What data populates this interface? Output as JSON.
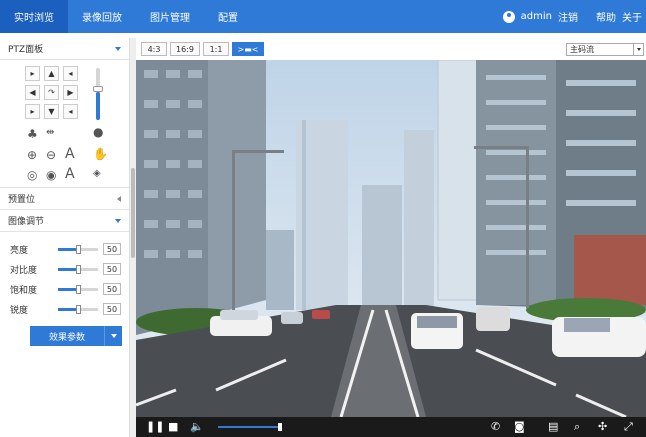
{
  "nav": {
    "tabs": [
      "实时浏览",
      "录像回放",
      "图片管理",
      "配置"
    ],
    "active_index": 0
  },
  "user": {
    "name": "admin",
    "logout": "注销",
    "help": "帮助",
    "about": "关于"
  },
  "ptz": {
    "title": "PTZ面板",
    "preset_title": "预置位",
    "image_title": "图像调节"
  },
  "image": {
    "rows": [
      {
        "label": "亮度",
        "value": "50",
        "level": 0.5
      },
      {
        "label": "对比度",
        "value": "50",
        "level": 0.5
      },
      {
        "label": "饱和度",
        "value": "50",
        "level": 0.5
      },
      {
        "label": "锐度",
        "value": "50",
        "level": 0.5
      }
    ],
    "effect_button": "效果参数"
  },
  "toolbar": {
    "ratios": [
      "4:3",
      "16:9",
      "1:1"
    ],
    "stream": "主码流"
  },
  "controls": {
    "volume_level": 1.0
  },
  "colors": {
    "accent": "#2f7ad6",
    "nav_active": "#1b5fbf"
  }
}
